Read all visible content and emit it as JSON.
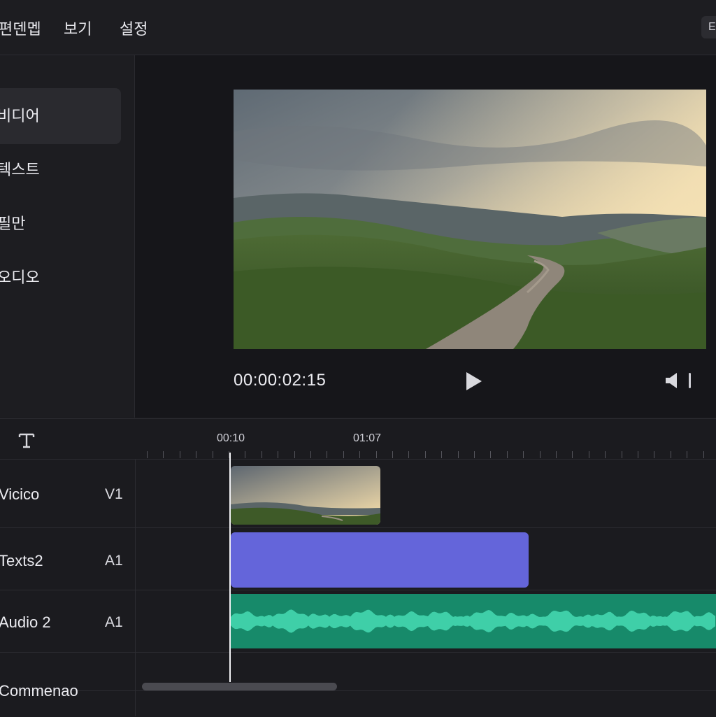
{
  "menu": {
    "edit": "편덴멥",
    "view": "보기",
    "settings": "설정",
    "export_label": "E"
  },
  "sidebar": {
    "items": [
      {
        "label": "비디어",
        "active": true,
        "icon": "video-icon"
      },
      {
        "label": "텍스트",
        "active": false,
        "icon": "text-icon"
      },
      {
        "label": "필만",
        "active": false,
        "icon": "filter-icon"
      },
      {
        "label": "오디오",
        "active": false,
        "icon": "audio-icon"
      }
    ]
  },
  "preview": {
    "timecode": "00:00:02:15",
    "play_icon": "play-icon",
    "volume_icon": "volume-icon"
  },
  "timeline": {
    "text_tool_icon": "text-tool-icon",
    "ruler_labels": [
      "00:10",
      "01:07"
    ],
    "tracks": [
      {
        "name": "Vicico",
        "id": "V1",
        "clip": "video-clip"
      },
      {
        "name": "Texts2",
        "id": "A1",
        "clip": "text-clip"
      },
      {
        "name": "Audio 2",
        "id": "A1",
        "clip": "audio-clip"
      },
      {
        "name": "Commenao",
        "id": "",
        "clip": ""
      }
    ]
  },
  "colors": {
    "text_clip": "#6465da",
    "audio_clip": "#178a6a",
    "waveform": "#3fcfa8",
    "background": "#1b1b1f"
  }
}
